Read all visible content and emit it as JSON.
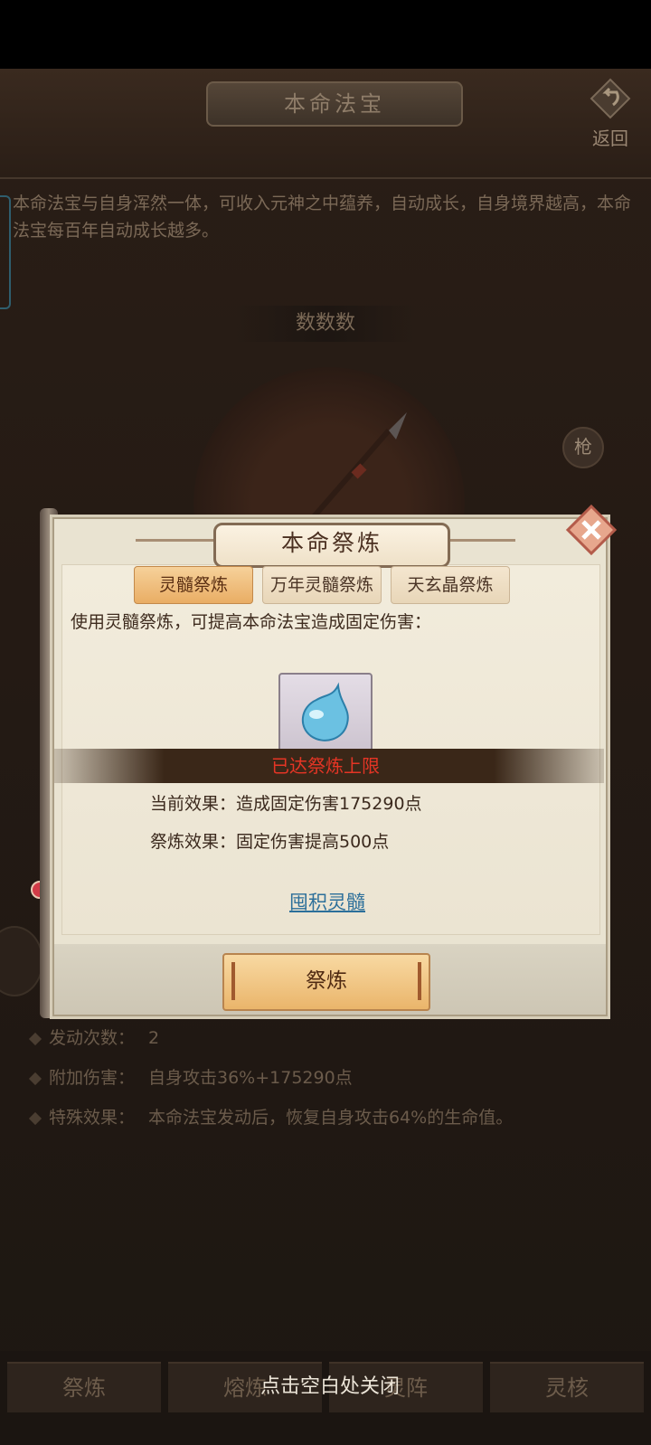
{
  "header": {
    "title": "本命法宝",
    "back_label": "返回"
  },
  "description": "本命法宝与自身浑然一体，可收入元神之中蕴养，自动成长，自身境界越高，本命法宝每百年自动成长越多。",
  "treasure": {
    "name": "数数数",
    "weapon_type": "枪"
  },
  "info_list": [
    {
      "label": "发动次数：",
      "value": "2"
    },
    {
      "label": "附加伤害：",
      "value": "自身攻击36%+175290点"
    },
    {
      "label": "特殊效果：",
      "value": "本命法宝发动后，恢复自身攻击64%的生命值。"
    }
  ],
  "bottom_tabs": [
    "祭炼",
    "熔炼",
    "灵阵",
    "灵核"
  ],
  "close_hint": "点击空白处关闭",
  "dialog": {
    "title": "本命祭炼",
    "tabs": [
      {
        "label": "灵髓祭炼",
        "active": true
      },
      {
        "label": "万年灵髓祭炼",
        "active": false
      },
      {
        "label": "天玄晶祭炼",
        "active": false
      }
    ],
    "instruction": "使用灵髓祭炼，可提高本命法宝造成固定伤害：",
    "limit_text": "已达祭炼上限",
    "current_effect": "当前效果：造成固定伤害175290点",
    "refine_effect": "祭炼效果：固定伤害提高500点",
    "link_label": "囤积灵髓",
    "refine_button": "祭炼"
  },
  "colors": {
    "limit_red": "#e53525",
    "link_blue": "#2c6f9a",
    "button_gold": "#eab56b"
  }
}
